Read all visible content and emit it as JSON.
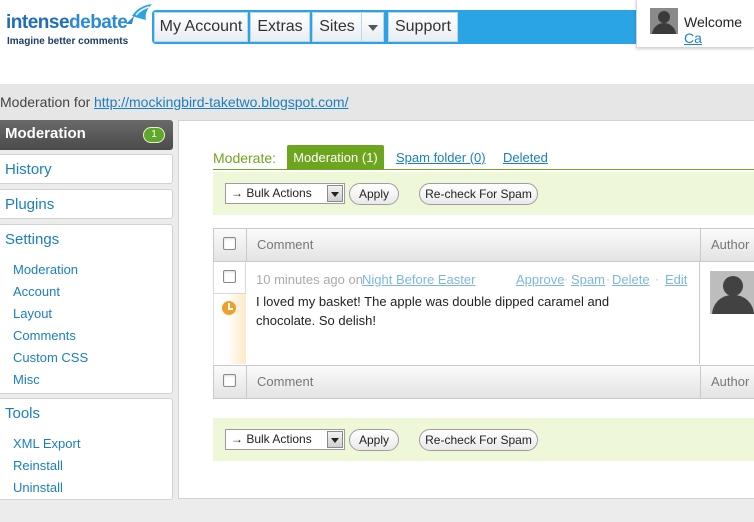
{
  "logo": {
    "part1": "intense",
    "part2": "debate",
    "tagline": "Imagine better comments"
  },
  "nav": {
    "my_account": "My Account",
    "extras": "Extras",
    "sites": "Sites",
    "support": "Support"
  },
  "user": {
    "welcome": "Welcome",
    "name": "Ca"
  },
  "breadcrumb": {
    "label": "Moderation for",
    "url": "http://mockingbird-taketwo.blogspot.com/"
  },
  "sidebar": {
    "active": {
      "label": "Moderation",
      "badge": "1"
    },
    "history": "History",
    "plugins": "Plugins",
    "settings": {
      "title": "Settings",
      "items": [
        "Moderation",
        "Account",
        "Layout",
        "Comments",
        "Custom CSS",
        "Misc"
      ]
    },
    "tools": {
      "title": "Tools",
      "items": [
        "XML Export",
        "Reinstall",
        "Uninstall"
      ]
    }
  },
  "moderate": {
    "label": "Moderate:",
    "tabs": {
      "moderation": "Moderation (1)",
      "spam": "Spam folder (0)",
      "deleted": "Deleted"
    }
  },
  "actions": {
    "bulk_select": "→ Bulk Actions",
    "apply": "Apply",
    "recheck": "Re-check For Spam"
  },
  "table": {
    "header": {
      "comment": "Comment",
      "author": "Author"
    },
    "rows": [
      {
        "time": "10 minutes ago on",
        "post": "Night Before Easter",
        "actions": {
          "approve": "Approve",
          "spam": "Spam",
          "delete": "Delete",
          "edit": "Edit"
        },
        "text": "I loved my basket! The apple was double dipped caramel and chocolate. So delish!"
      }
    ]
  },
  "colors": {
    "nav_blue": "#2aa4e4",
    "accent_green": "#6ea51e",
    "link_blue": "#1a7fc0",
    "action_bar_bg": "#eef8d8"
  }
}
